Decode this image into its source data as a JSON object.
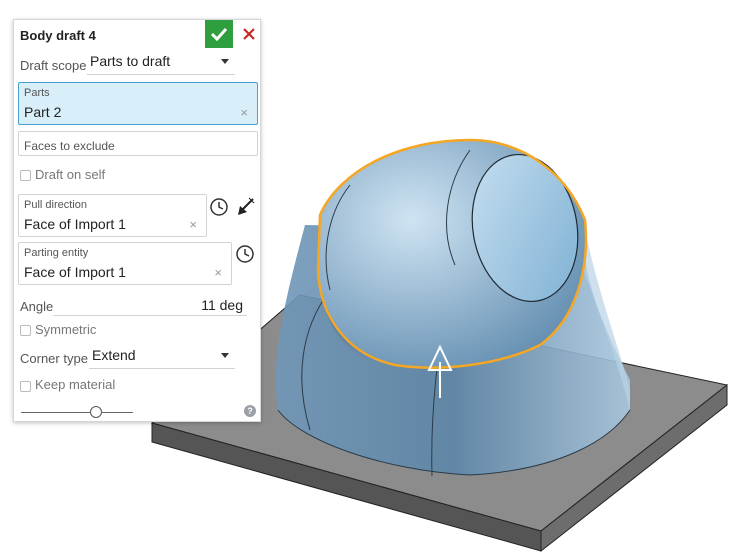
{
  "dialog": {
    "title": "Body draft 4",
    "ok_icon": "checkmark-icon",
    "cancel_icon": "close-icon"
  },
  "draft_scope": {
    "label": "Draft scope",
    "value": "Parts to draft"
  },
  "parts": {
    "label": "Parts",
    "value": "Part 2",
    "clear": "×"
  },
  "faces_to_exclude": {
    "placeholder": "Faces to exclude"
  },
  "draft_on_self": {
    "label": "Draft on self",
    "checked": false
  },
  "pull_direction": {
    "label": "Pull direction",
    "value": "Face of Import 1",
    "clear": "×"
  },
  "parting_entity": {
    "label": "Parting entity",
    "value": "Face of Import 1",
    "clear": "×"
  },
  "angle": {
    "label": "Angle",
    "value": "11 deg"
  },
  "symmetric": {
    "label": "Symmetric",
    "checked": false
  },
  "corner_type": {
    "label": "Corner type",
    "value": "Extend"
  },
  "keep_material": {
    "label": "Keep material",
    "checked": false
  },
  "slider": {
    "level": 0.66
  },
  "help": {
    "glyph": "?"
  },
  "colors": {
    "accent": "#2e9e3e",
    "cancel": "#c62828",
    "selection": "#f5a623",
    "part_fill": "#7ea9c9",
    "plate": "#8a8a8a"
  }
}
